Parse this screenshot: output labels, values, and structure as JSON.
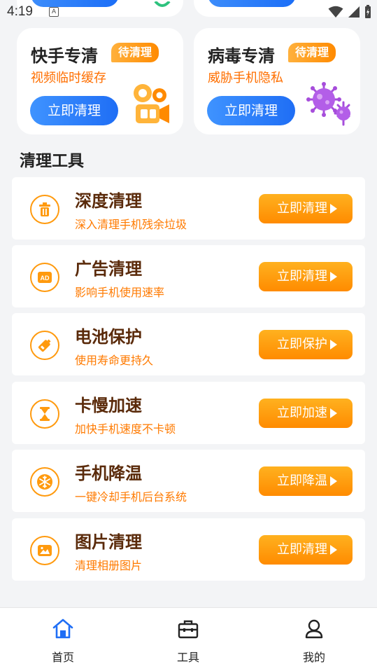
{
  "status_bar": {
    "time": "4:19",
    "notif_letter": "A"
  },
  "cards": [
    {
      "title": "快手专清",
      "badge": "待清理",
      "subtitle": "视频临时缓存",
      "button": "立即清理",
      "icon": "kuaishou-icon"
    },
    {
      "title": "病毒专清",
      "badge": "待清理",
      "subtitle": "威胁手机隐私",
      "button": "立即清理",
      "icon": "virus-icon"
    }
  ],
  "section_title": "清理工具",
  "tools": [
    {
      "title": "深度清理",
      "subtitle": "深入清理手机残余垃圾",
      "button": "立即清理",
      "icon": "trash-icon"
    },
    {
      "title": "广告清理",
      "subtitle": "影响手机使用速率",
      "button": "立即清理",
      "icon": "ad-icon"
    },
    {
      "title": "电池保护",
      "subtitle": "使用寿命更持久",
      "button": "立即保护",
      "icon": "battery-icon"
    },
    {
      "title": "卡慢加速",
      "subtitle": "加快手机速度不卡顿",
      "button": "立即加速",
      "icon": "hourglass-icon"
    },
    {
      "title": "手机降温",
      "subtitle": "一键冷却手机后台系统",
      "button": "立即降温",
      "icon": "snowflake-icon"
    },
    {
      "title": "图片清理",
      "subtitle": "清理相册图片",
      "button": "立即清理",
      "icon": "image-icon"
    }
  ],
  "nav": [
    {
      "label": "首页",
      "icon": "home-icon",
      "active": true
    },
    {
      "label": "工具",
      "icon": "toolbox-icon",
      "active": false
    },
    {
      "label": "我的",
      "icon": "user-icon",
      "active": false
    }
  ],
  "colors": {
    "accent_orange": "#ff8b00",
    "accent_blue": "#1f6ef5",
    "title_brown": "#5a2a0a"
  }
}
